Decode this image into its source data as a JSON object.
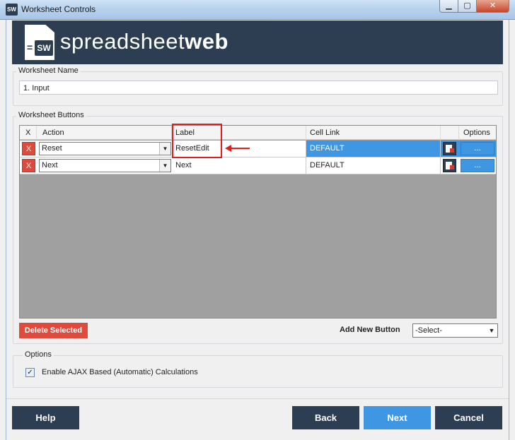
{
  "window": {
    "icon_text": "SW",
    "title": "Worksheet Controls",
    "minimize": "▁",
    "maximize": "▢",
    "close": "✕"
  },
  "logo": {
    "badge": "SW",
    "prefix": "spreadsheet",
    "suffix": "web"
  },
  "worksheet_name": {
    "legend": "Worksheet Name",
    "value": "1. Input"
  },
  "worksheet_buttons": {
    "legend": "Worksheet Buttons",
    "columns": [
      "X",
      "Action",
      "Label",
      "Cell Link",
      "Options"
    ],
    "rows": [
      {
        "delete": "X",
        "action": "Reset",
        "label": "ResetEdit",
        "cell_link": "DEFAULT",
        "options": "...",
        "selected": true
      },
      {
        "delete": "X",
        "action": "Next",
        "label": "Next",
        "cell_link": "DEFAULT",
        "options": "...",
        "selected": false
      }
    ],
    "delete_selected": "Delete Selected",
    "add_new_label": "Add New Button",
    "add_new_select": "-Select-"
  },
  "options": {
    "legend": "Options",
    "ajax_label": "Enable AJAX Based (Automatic) Calculations",
    "ajax_checked": true,
    "check_mark": "✓"
  },
  "footer": {
    "help": "Help",
    "back": "Back",
    "next": "Next",
    "cancel": "Cancel"
  },
  "colors": {
    "navy": "#2d3e53",
    "blue": "#3f97e4",
    "red": "#e04a3c"
  }
}
